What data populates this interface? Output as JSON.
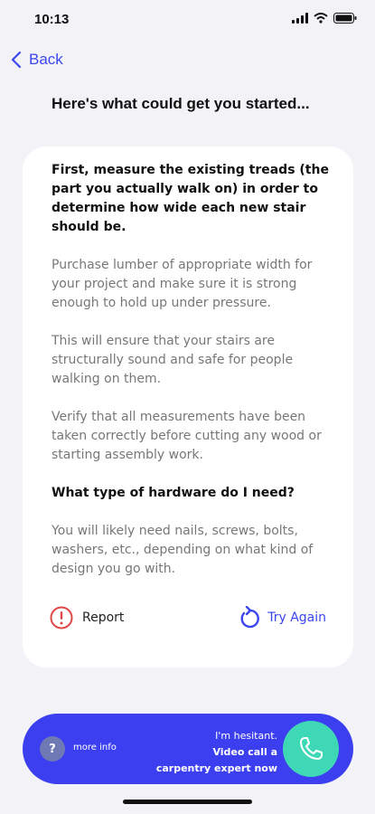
{
  "status_bar": {
    "time": "10:13"
  },
  "nav": {
    "back_label": "Back"
  },
  "heading": "Here's what could get you started...",
  "card": {
    "intro_bold": "First, measure the existing treads (the part you actually walk on) in order to determine how wide each new stair should be.",
    "para1": "Purchase lumber of appropriate width for your project and make sure it is strong enough to hold up under pressure.",
    "para2": "This will ensure that your stairs are structurally sound and safe for people walking on them.",
    "para3": "Verify that all measurements have been taken correctly before cutting any wood or starting assembly work.",
    "question_bold": "What type of hardware do I need?",
    "para4": "You will likely need nails, screws, bolts, washers, etc., depending on what kind of design you go with.",
    "report_label": "Report",
    "try_again_label": "Try Again"
  },
  "bottom_bar": {
    "more_info_icon": "?",
    "more_info_label": "more info",
    "video_line1": "I'm hesitant.",
    "video_line2": "Video call a",
    "video_line3": "carpentry expert now"
  },
  "colors": {
    "accent": "#3b46f1",
    "bar": "#3c3ff0",
    "call": "#3fd8b6",
    "report": "#e04848"
  }
}
